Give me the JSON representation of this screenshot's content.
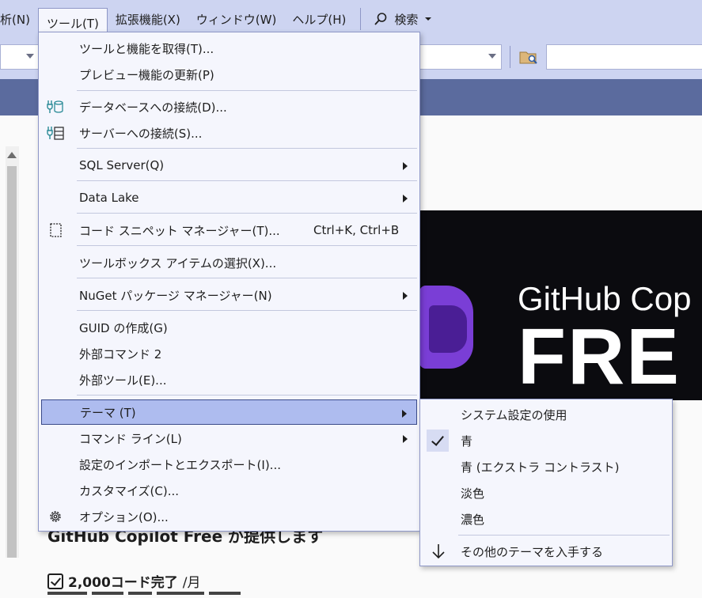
{
  "menubar": {
    "items": [
      {
        "label": "析(N)"
      },
      {
        "label": "ツール(T)"
      },
      {
        "label": "拡張機能(X)"
      },
      {
        "label": "ウィンドウ(W)"
      },
      {
        "label": "ヘルプ(H)"
      }
    ],
    "search_label": "検索"
  },
  "tools_menu": {
    "items": [
      {
        "label": "ツールと機能を取得(T)..."
      },
      {
        "label": "プレビュー機能の更新(P)"
      },
      {
        "label": "データベースへの接続(D)...",
        "icon": "database-connect-icon"
      },
      {
        "label": "サーバーへの接続(S)...",
        "icon": "server-connect-icon"
      },
      {
        "label": "SQL Server(Q)"
      },
      {
        "label": "Data Lake"
      },
      {
        "label": "コード スニペット マネージャー(T)...",
        "shortcut": "Ctrl+K, Ctrl+B",
        "icon": "snippet-icon"
      },
      {
        "label": "ツールボックス アイテムの選択(X)..."
      },
      {
        "label": "NuGet パッケージ マネージャー(N)"
      },
      {
        "label": "GUID の作成(G)"
      },
      {
        "label": "外部コマンド 2"
      },
      {
        "label": "外部ツール(E)..."
      },
      {
        "label": "テーマ (T)"
      },
      {
        "label": "コマンド ライン(L)"
      },
      {
        "label": "設定のインポートとエクスポート(I)..."
      },
      {
        "label": "カスタマイズ(C)..."
      },
      {
        "label": "オプション(O)...",
        "icon": "gear-icon"
      }
    ]
  },
  "theme_submenu": {
    "items": [
      {
        "label": "システム設定の使用",
        "checked": false
      },
      {
        "label": "青",
        "checked": true
      },
      {
        "label": "青 (エクストラ コントラスト)",
        "checked": false
      },
      {
        "label": "淡色",
        "checked": false
      },
      {
        "label": "濃色",
        "checked": false
      },
      {
        "label": "その他のテーマを入手する",
        "icon": "download-arrow-icon"
      }
    ]
  },
  "banner": {
    "line1": "GitHub Cop",
    "line2": "FRE"
  },
  "document": {
    "heading": "GitHub Copilot Free が提供します",
    "bullet_value": "2,000コード完了",
    "bullet_unit": "/月"
  },
  "colors": {
    "accent_highlight": "#aebcef",
    "menu_background": "#f5f6fd",
    "menubar_background": "#cdd4f1",
    "title_band": "#5b6b9e"
  }
}
